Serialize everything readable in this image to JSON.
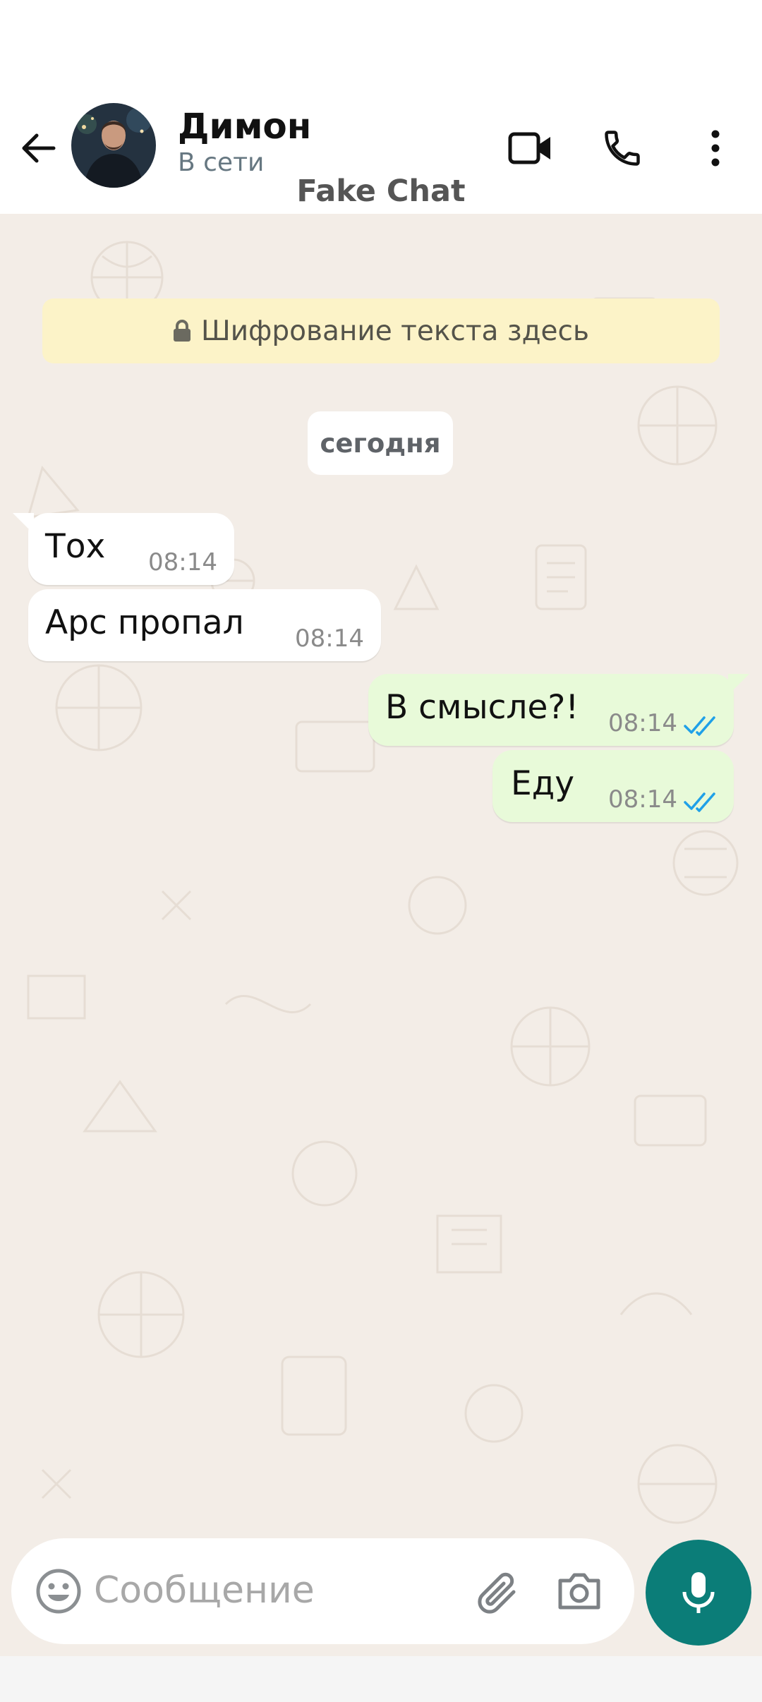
{
  "header": {
    "contact_name": "Димон",
    "contact_status": "В сети",
    "brand": "Fake Chat",
    "icons": [
      "back-arrow-icon",
      "video-call-icon",
      "phone-call-icon",
      "more-options-icon"
    ]
  },
  "chat": {
    "encryption_notice": "Шифрование текста здесь",
    "date_divider": "сегодня",
    "messages": [
      {
        "direction": "incoming",
        "text": "Тох",
        "time": "08:14"
      },
      {
        "direction": "incoming",
        "text": "Арс пропал",
        "time": "08:14"
      },
      {
        "direction": "outgoing",
        "text": "В смысле?!",
        "time": "08:14",
        "status": "read"
      },
      {
        "direction": "outgoing",
        "text": "Еду",
        "time": "08:14",
        "status": "read"
      }
    ]
  },
  "composer": {
    "placeholder": "Сообщение",
    "icons": [
      "emoji-icon",
      "attach-icon",
      "camera-icon",
      "mic-icon"
    ]
  },
  "colors": {
    "chat_background": "#f3ede7",
    "outgoing_bubble": "#e8fad9",
    "incoming_bubble": "#ffffff",
    "accent": "#0b7d78",
    "read_ticks": "#1fa0e8"
  }
}
